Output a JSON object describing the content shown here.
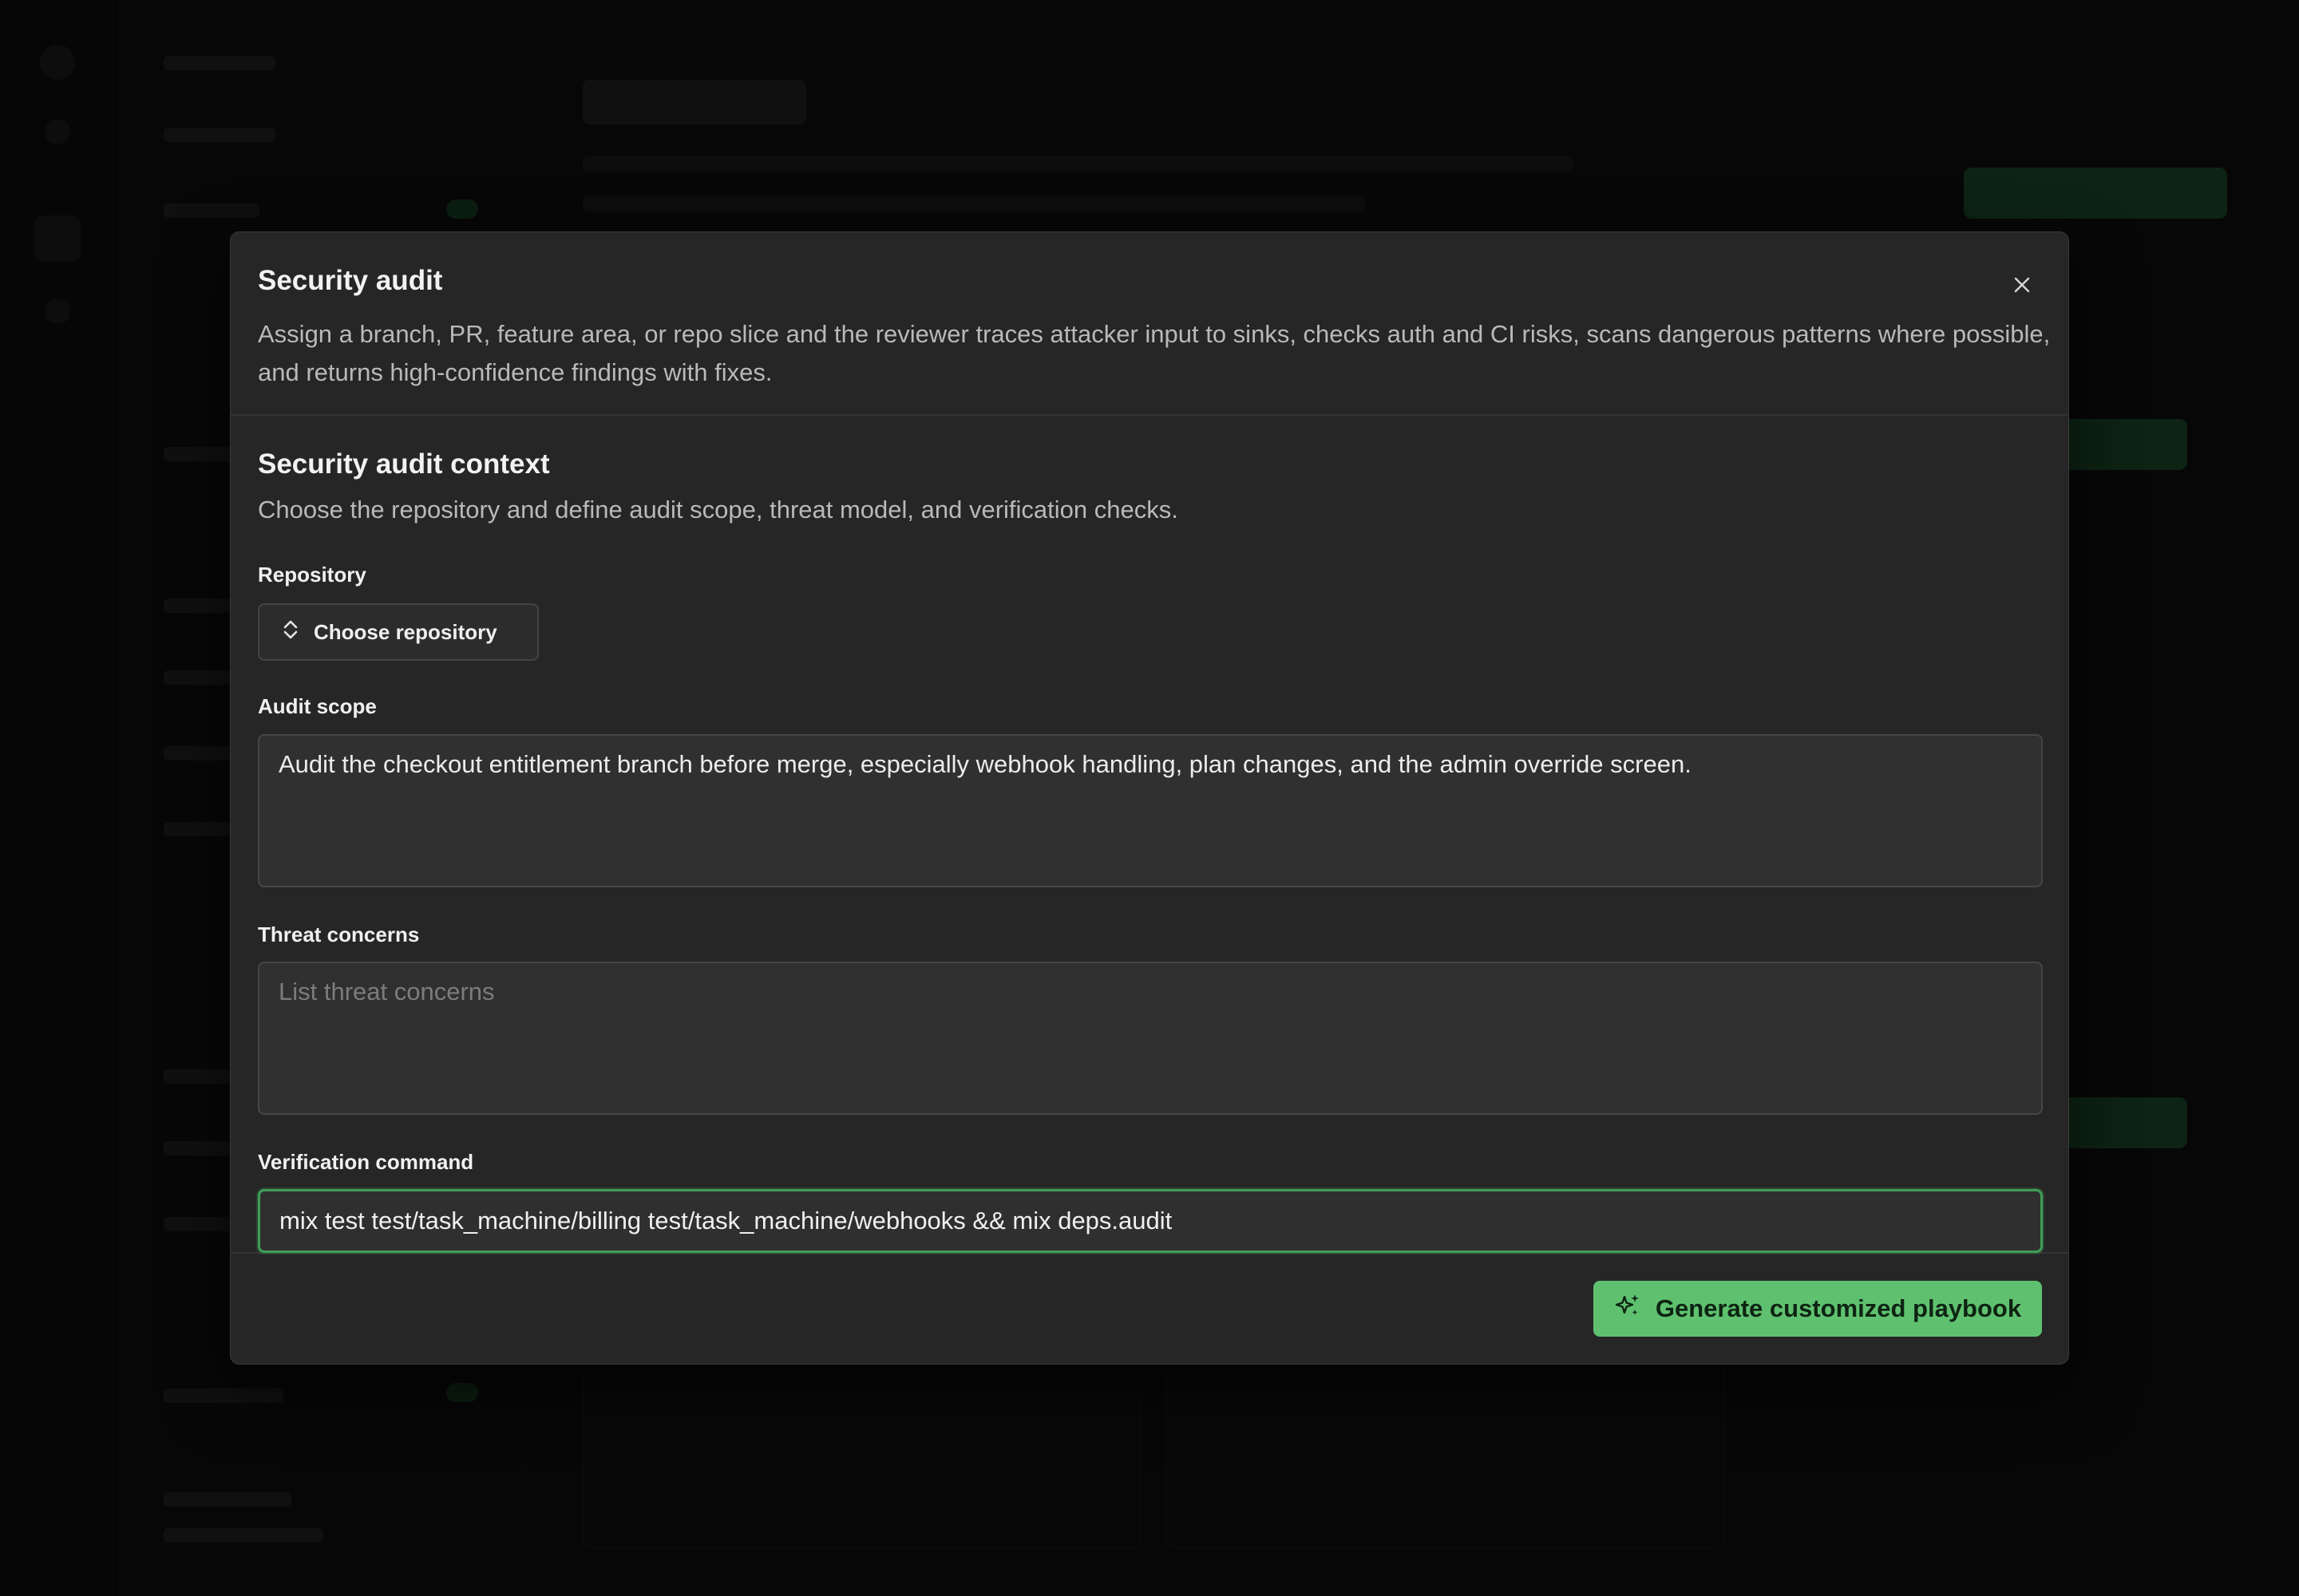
{
  "modal": {
    "title": "Security audit",
    "description": "Assign a branch, PR, feature area, or repo slice and the reviewer traces attacker input to sinks, checks auth and CI risks, scans dangerous patterns where possible, and returns high-confidence findings with fixes.",
    "close_icon": "close-icon"
  },
  "context": {
    "title": "Security audit context",
    "description": "Choose the repository and define audit scope, threat model, and verification checks."
  },
  "repository": {
    "label": "Repository",
    "button_label": "Choose repository",
    "icon": "chevron-up-down-icon"
  },
  "audit_scope": {
    "label": "Audit scope",
    "value": "Audit the checkout entitlement branch before merge, especially webhook handling, plan changes, and the admin override screen."
  },
  "threat_concerns": {
    "label": "Threat concerns",
    "value": "",
    "placeholder": "List threat concerns"
  },
  "verification": {
    "label": "Verification command",
    "value": "mix test test/task_machine/billing test/task_machine/webhooks && mix deps.audit"
  },
  "footer": {
    "generate_label": "Generate customized playbook",
    "generate_icon": "sparkles-icon"
  },
  "colors": {
    "accent": "#5fc16f",
    "focus_border": "#3f9e57",
    "modal_bg": "#262626"
  }
}
